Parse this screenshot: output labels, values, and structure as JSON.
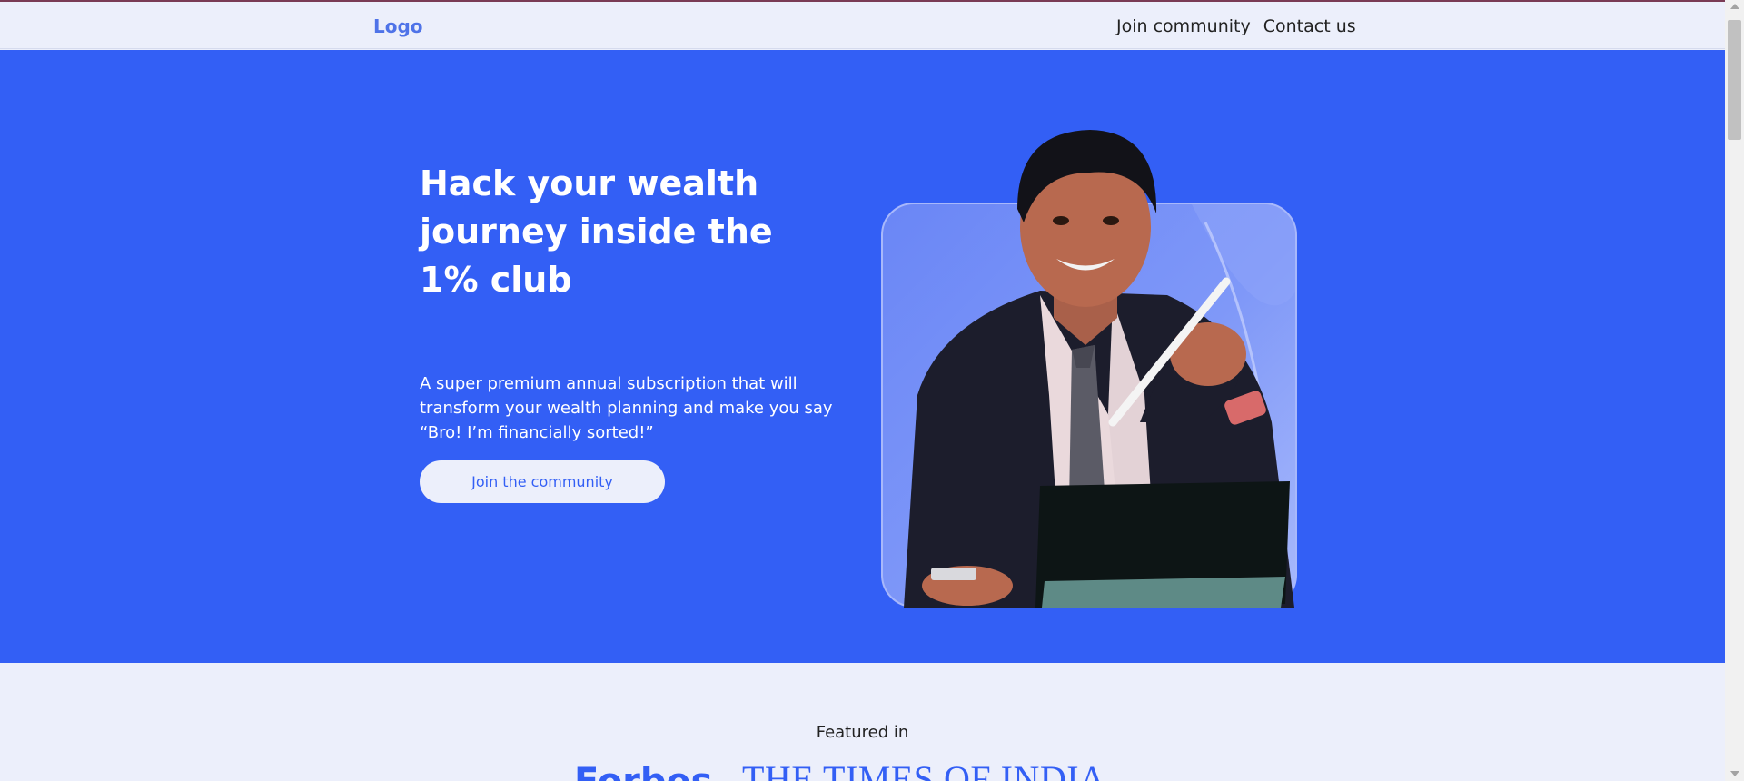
{
  "nav": {
    "logo": "Logo",
    "links": [
      "Join community",
      "Contact us"
    ]
  },
  "hero": {
    "title": "Hack your wealth journey inside the 1% club",
    "subtitle": "A super premium annual subscription that will transform your wealth planning and make you say “Bro! I’m financially sorted!”",
    "cta_label": "Join the community",
    "image_icon": "man-pointing-with-stylus-photo"
  },
  "featured": {
    "label": "Featured in",
    "brands": [
      "Forbes",
      "THE TIMES OF INDIA"
    ]
  },
  "colors": {
    "primary": "#335ff5",
    "background": "#eceffb",
    "logo": "#4f73e8"
  }
}
